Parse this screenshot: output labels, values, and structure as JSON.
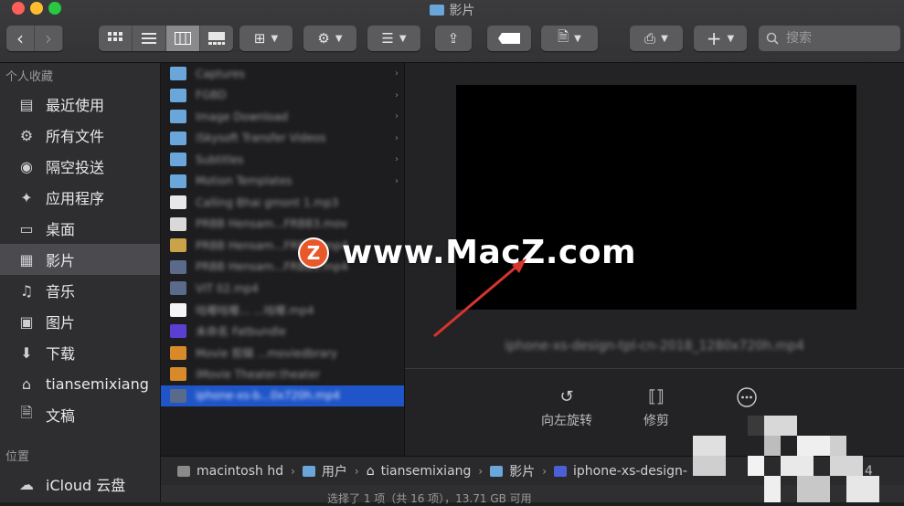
{
  "window": {
    "title": "影片"
  },
  "toolbar": {
    "back": "‹",
    "forward": "›",
    "view_icon": "⊞",
    "action_icon": "⚙",
    "share_icon": "⇪",
    "add_icon": "+",
    "search_placeholder": "搜索"
  },
  "sidebar": {
    "favorites_title": "个人收藏",
    "items": [
      {
        "label": "最近使用",
        "icon": "recents-icon"
      },
      {
        "label": "所有文件",
        "icon": "all-files-icon"
      },
      {
        "label": "隔空投送",
        "icon": "airdrop-icon"
      },
      {
        "label": "应用程序",
        "icon": "applications-icon"
      },
      {
        "label": "桌面",
        "icon": "desktop-icon"
      },
      {
        "label": "影片",
        "icon": "movies-icon",
        "selected": true
      },
      {
        "label": "音乐",
        "icon": "music-icon"
      },
      {
        "label": "图片",
        "icon": "pictures-icon"
      },
      {
        "label": "下载",
        "icon": "downloads-icon"
      },
      {
        "label": "tiansemixiang",
        "icon": "home-icon"
      },
      {
        "label": "文稿",
        "icon": "documents-icon"
      }
    ],
    "locations_title": "位置",
    "icloud": "iCloud 云盘"
  },
  "files": [
    {
      "name": "Captures",
      "type": "folder",
      "arrow": "›"
    },
    {
      "name": "FGBD",
      "type": "folder",
      "arrow": "›"
    },
    {
      "name": "Image Download",
      "type": "folder",
      "arrow": "›"
    },
    {
      "name": "iSkysoft Transfer Videos",
      "type": "folder",
      "arrow": "›"
    },
    {
      "name": "Subtitles",
      "type": "folder",
      "arrow": "›"
    },
    {
      "name": "Motion Templates",
      "type": "folder",
      "arrow": "›"
    },
    {
      "name": "Calling Bhai gmont 1.mp3",
      "type": "audio"
    },
    {
      "name": "PRBB Hensam...FRBB3.mov",
      "type": "doc"
    },
    {
      "name": "PRBB Hensam...FRBB3.mp4",
      "type": "image"
    },
    {
      "name": "PRBB Hensam...FRBB3.mp4",
      "type": "video"
    },
    {
      "name": "VIT 02.mp4",
      "type": "video"
    },
    {
      "name": "咕嘟咕嘟... ...咕嘟.mp4",
      "type": "white"
    },
    {
      "name": "未命名 Fatbundle",
      "type": "stars"
    },
    {
      "name": "Movie 剪辑 ...moviedbrary",
      "type": "orange"
    },
    {
      "name": "iMovie Theater.theater",
      "type": "orange"
    },
    {
      "name": "iphone-xs-b...0x720h.mp4",
      "type": "video",
      "selected": true
    }
  ],
  "preview": {
    "filename": "iphone-xs-design-tpl-cn-2018_1280x720h.mp4",
    "actions": [
      {
        "label": "向左旋转",
        "icon": "rotate-left-icon"
      },
      {
        "label": "修剪",
        "icon": "trim-icon"
      },
      {
        "label": "",
        "icon": "more-icon"
      }
    ]
  },
  "pathbar": {
    "items": [
      "macintosh hd",
      "用户",
      "tiansemixiang",
      "影片",
      "iphone-xs-design-"
    ],
    "trailing": "4"
  },
  "status": "选择了 1 项（共 16 项），13.71 GB 可用",
  "watermark": {
    "logo": "Z",
    "text": "www.MacZ.com"
  },
  "colors": {
    "selection": "#1f55c8",
    "folder": "#6aa6da",
    "watermark_logo": "#e9582a",
    "arrow": "#d8342e"
  }
}
